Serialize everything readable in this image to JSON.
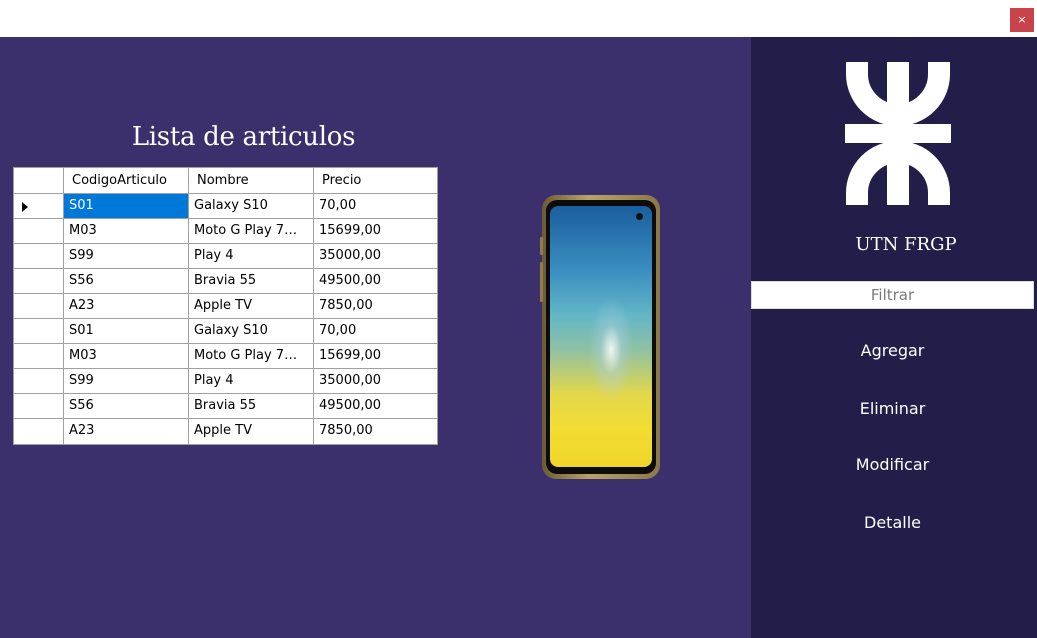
{
  "window": {
    "close_glyph": "×"
  },
  "main": {
    "title": "Lista de articulos",
    "grid": {
      "columns": [
        "CodigoArticulo",
        "Nombre",
        "Precio"
      ],
      "selected_row": 0,
      "rows": [
        {
          "code": "S01",
          "name": "Galaxy S10",
          "price": "70,00"
        },
        {
          "code": "M03",
          "name": "Moto G Play 7m...",
          "price": "15699,00"
        },
        {
          "code": "S99",
          "name": "Play 4",
          "price": "35000,00"
        },
        {
          "code": "S56",
          "name": "Bravia 55",
          "price": "49500,00"
        },
        {
          "code": "A23",
          "name": "Apple TV",
          "price": "7850,00"
        },
        {
          "code": "S01",
          "name": "Galaxy S10",
          "price": "70,00"
        },
        {
          "code": "M03",
          "name": "Moto G Play 7m...",
          "price": "15699,00"
        },
        {
          "code": "S99",
          "name": "Play 4",
          "price": "35000,00"
        },
        {
          "code": "S56",
          "name": "Bravia 55",
          "price": "49500,00"
        },
        {
          "code": "A23",
          "name": "Apple TV",
          "price": "7850,00"
        }
      ]
    },
    "preview_image": "smartphone-image"
  },
  "sidebar": {
    "logo": "utn-logo-icon",
    "brand": "UTN FRGP",
    "filter_placeholder": "Filtrar",
    "buttons": {
      "add": "Agregar",
      "delete": "Eliminar",
      "modify": "Modificar",
      "detail": "Detalle"
    }
  },
  "colors": {
    "main_bg": "#3c306c",
    "sidebar_bg": "#221d49",
    "selection": "#0078d7",
    "close_button": "#c9434a"
  }
}
